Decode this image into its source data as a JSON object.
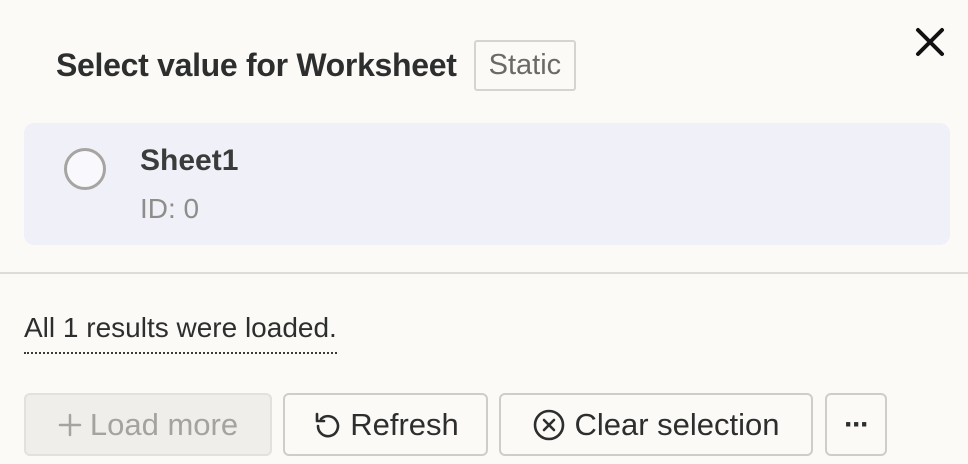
{
  "header": {
    "title": "Select value for Worksheet",
    "badge": "Static",
    "close_icon": "close-icon"
  },
  "options": [
    {
      "title": "Sheet1",
      "subtitle": "ID: 0",
      "selected": false
    }
  ],
  "status": {
    "results_text": "All 1 results were loaded."
  },
  "actions": {
    "load_more": {
      "label": "Load more",
      "icon": "plus-icon",
      "disabled": true
    },
    "refresh": {
      "label": "Refresh",
      "icon": "refresh-icon"
    },
    "clear": {
      "label": "Clear selection",
      "icon": "clear-circle-x-icon"
    },
    "more": {
      "label": "···",
      "icon": "more-dots-icon"
    }
  },
  "colors": {
    "background": "#fbfaf7",
    "option_background": "#f0f0f9",
    "text": "#2d2e2e",
    "muted_text": "#8e8d89"
  }
}
